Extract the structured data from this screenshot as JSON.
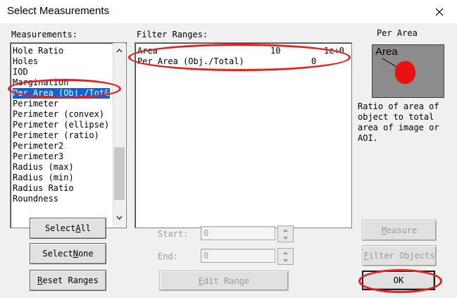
{
  "window": {
    "title": "Select Measurements"
  },
  "measurements": {
    "label": "Measurements:",
    "items": [
      "Hole Ratio",
      "Holes",
      "IOD",
      "Margination",
      "Per Area (Obj./Tot&",
      "Perimeter",
      "Perimeter (convex)",
      "Perimeter (ellipse)",
      "Perimeter (ratio)",
      "Perimeter2",
      "Perimeter3",
      "Radius (max)",
      "Radius (min)",
      "Radius Ratio",
      "Roundness"
    ],
    "selected_index": 4
  },
  "filter": {
    "label": "Filter Ranges:",
    "rows": [
      {
        "name": "Area",
        "min": "10",
        "max": "1e+0"
      },
      {
        "name": "Per Area (Obj./Total)",
        "min": "0",
        "max": ""
      }
    ]
  },
  "preview": {
    "label": "Per Area",
    "image_text": "Area",
    "description_lines": [
      "Ratio of area of",
      "object to total",
      "area of image or",
      "AOI."
    ]
  },
  "buttons": {
    "select_all_pre": "Select ",
    "select_all_key": "A",
    "select_all_post": "ll",
    "select_none_pre": "Select ",
    "select_none_key": "N",
    "select_none_post": "one",
    "reset_key": "R",
    "reset_post": "eset Ranges",
    "edit_key": "E",
    "edit_post": "dit Range",
    "measure_key": "M",
    "measure_post": "easure",
    "filter_key": "F",
    "filter_post": "ilter Objects",
    "ok": "OK"
  },
  "range": {
    "start_label": "Start:",
    "start_value": "0",
    "end_label": "End:",
    "end_value": "0"
  },
  "colors": {
    "selection": "#0a64d8",
    "annotation": "#e5201e",
    "blob": "#e81010"
  }
}
